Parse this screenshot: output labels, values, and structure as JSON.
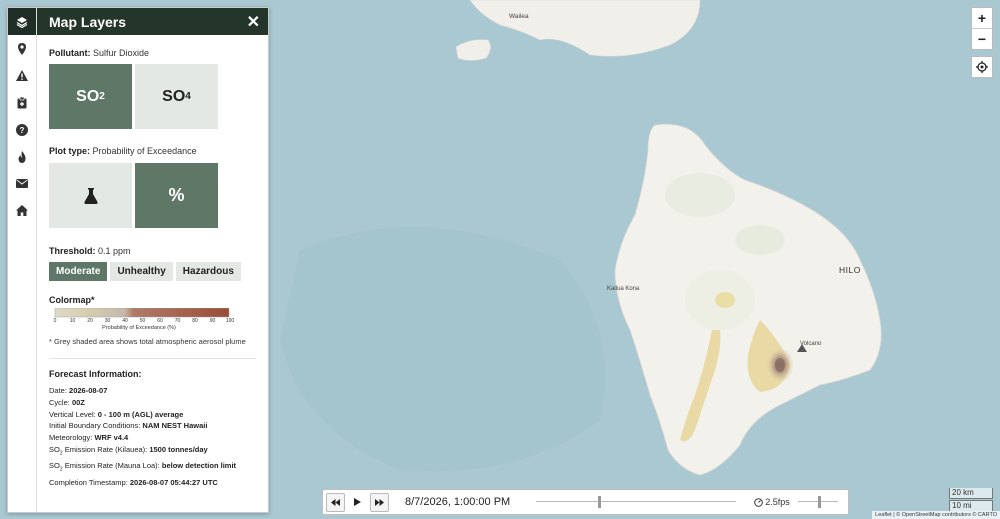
{
  "sidebar": {
    "tabs": [
      {
        "icon": "layers-icon"
      },
      {
        "icon": "map-marker-icon"
      },
      {
        "icon": "warning-icon"
      },
      {
        "icon": "clipboard-icon"
      },
      {
        "icon": "question-icon"
      },
      {
        "icon": "flame-icon"
      },
      {
        "icon": "envelope-icon"
      },
      {
        "icon": "home-icon"
      }
    ],
    "title": "Map Layers",
    "close": "✕"
  },
  "pollutant": {
    "label": "Pollutant:",
    "value": "Sulfur Dioxide",
    "options": [
      {
        "base": "SO",
        "sub": "2",
        "selected": true
      },
      {
        "base": "SO",
        "sub": "4",
        "selected": false
      }
    ]
  },
  "plot_type": {
    "label": "Plot type:",
    "value": "Probability of Exceedance",
    "options": [
      {
        "icon": "flask-icon",
        "selected": false
      },
      {
        "glyph": "%",
        "selected": true
      }
    ]
  },
  "threshold": {
    "label": "Threshold:",
    "value": "0.1 ppm",
    "options": [
      {
        "label": "Moderate",
        "selected": true
      },
      {
        "label": "Unhealthy",
        "selected": false
      },
      {
        "label": "Hazardous",
        "selected": false
      }
    ]
  },
  "colormap": {
    "label": "Colormap*",
    "ticks": [
      "0",
      "10",
      "20",
      "30",
      "40",
      "50",
      "60",
      "70",
      "80",
      "90",
      "100"
    ],
    "caption": "Probability of Exceedance (%)",
    "note": "* Grey shaded area shows total atmospheric aerosol plume"
  },
  "forecast": {
    "heading": "Forecast Information:",
    "date_label": "Date:",
    "date": "2026-08-07",
    "cycle_label": "Cycle:",
    "cycle": "00Z",
    "vlevel_label": "Vertical Level:",
    "vlevel": "0 - 100 m (AGL) average",
    "ibc_label": "Initial Boundary Conditions:",
    "ibc": "NAM NEST Hawaii",
    "met_label": "Meteorology:",
    "met": "WRF v4.4",
    "kil_pre": "SO",
    "kil_sub": "2",
    "kil_label": " Emission Rate (Kilauea):",
    "kil": "1500 tonnes/day",
    "ml_pre": "SO",
    "ml_sub": "2",
    "ml_label": " Emission Rate (Mauna Loa):",
    "ml": "below detection limit",
    "comp_label": "Completion Timestamp:",
    "comp": "2026-08-07 05:44:27 UTC"
  },
  "map": {
    "places": {
      "wailea": "Wailea",
      "kona": "Kailua Kona",
      "hilo": "HILO",
      "volcano": "Volcano"
    },
    "zoom_in": "+",
    "zoom_out": "−",
    "attribution": "Leaflet | © OpenStreetMap contributors © CARTO"
  },
  "timebar": {
    "time": "8/7/2026, 1:00:00 PM",
    "fps": "2.5fps",
    "playback_position": 0.31,
    "speed_position": 0.5
  },
  "scale": {
    "km": "20 km",
    "mi": "10 mi"
  },
  "colors": {
    "accent": "#5f7767",
    "header": "#243529",
    "ocean": "#a9c8d2",
    "land": "#f3f1ec"
  }
}
